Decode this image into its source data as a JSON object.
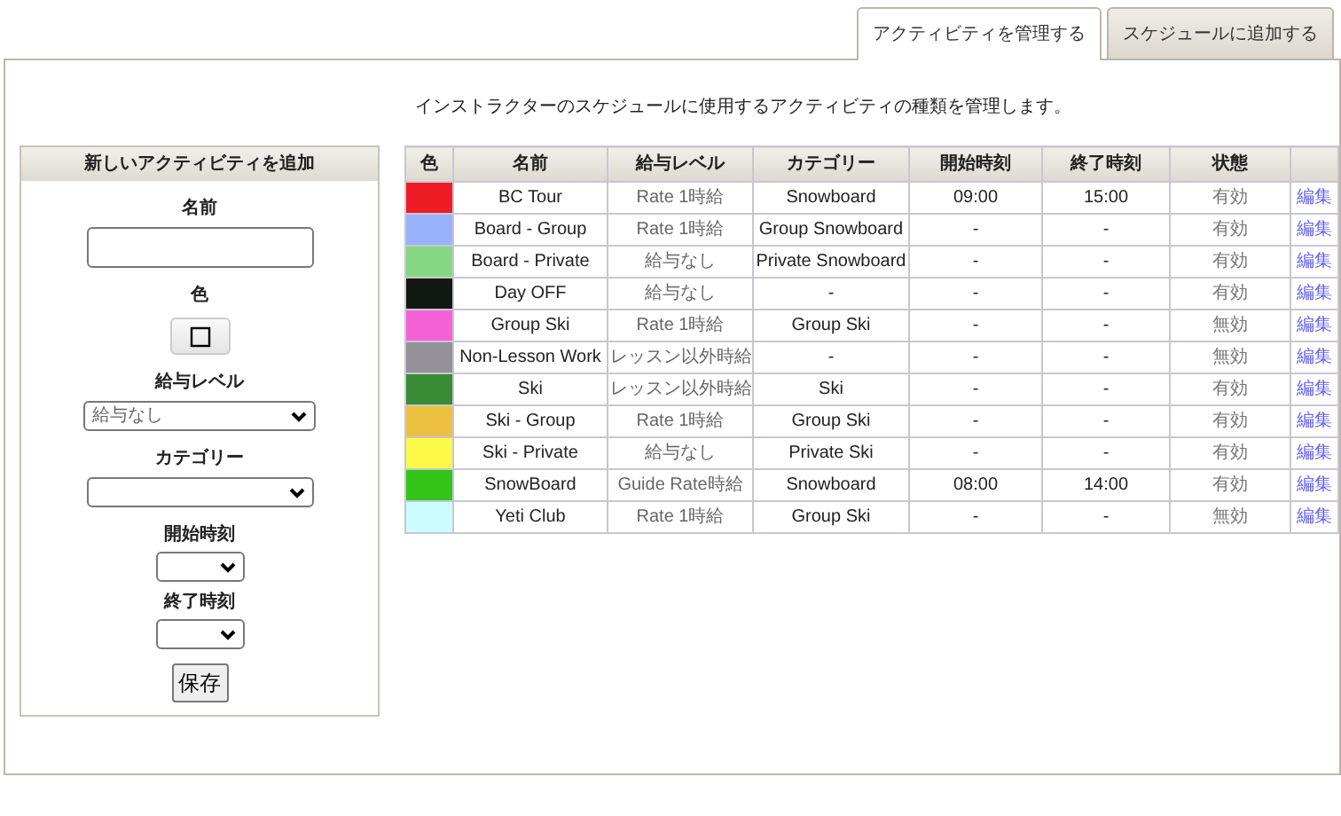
{
  "tabs": [
    {
      "label": "アクティビティを管理する",
      "selected": true
    },
    {
      "label": "スケジュールに追加する",
      "selected": false
    }
  ],
  "description": "インストラクターのスケジュールに使用するアクティビティの種類を管理します。",
  "form": {
    "title": "新しいアクティビティを追加",
    "fields": [
      {
        "label": "名前",
        "kind": "text"
      },
      {
        "label": "色",
        "kind": "color"
      },
      {
        "label": "給与レベル",
        "kind": "select",
        "value": "給与なし"
      },
      {
        "label": "カテゴリー",
        "kind": "select"
      },
      {
        "label": "開始時刻",
        "kind": "time"
      },
      {
        "label": "終了時刻",
        "kind": "time"
      }
    ],
    "save_button": "保存"
  },
  "table": {
    "columns": [
      "色",
      "名前",
      "給与レベル",
      "カテゴリー",
      "開始時刻",
      "終了時刻",
      "状態"
    ],
    "rows": [
      {
        "color": "#ee1c25",
        "name": "BC Tour",
        "pay_level": "Rate 1時給",
        "category": "Snowboard",
        "start": "09:00",
        "end": "15:00",
        "status": "有効",
        "action": "編集"
      },
      {
        "color": "#99b3fa",
        "name": "Board - Group",
        "pay_level": "Rate 1時給",
        "category": "Group Snowboard",
        "start": "-",
        "end": "-",
        "status": "有効",
        "action": "編集"
      },
      {
        "color": "#86d784",
        "name": "Board - Private",
        "pay_level": "給与なし",
        "category": "Private Snowboard",
        "start": "-",
        "end": "-",
        "status": "有効",
        "action": "編集"
      },
      {
        "color": "#111811",
        "name": "Day OFF",
        "pay_level": "給与なし",
        "category": "-",
        "start": "-",
        "end": "-",
        "status": "有効",
        "action": "編集"
      },
      {
        "color": "#f562d5",
        "name": "Group Ski",
        "pay_level": "Rate 1時給",
        "category": "Group Ski",
        "start": "-",
        "end": "-",
        "status": "無効",
        "action": "編集"
      },
      {
        "color": "#959199",
        "name": "Non-Lesson Work",
        "pay_level": "レッスン以外時給",
        "category": "-",
        "start": "-",
        "end": "-",
        "status": "無効",
        "action": "編集"
      },
      {
        "color": "#3a8b33",
        "name": "Ski",
        "pay_level": "レッスン以外時給",
        "category": "Ski",
        "start": "-",
        "end": "-",
        "status": "有効",
        "action": "編集"
      },
      {
        "color": "#ecc040",
        "name": "Ski - Group",
        "pay_level": "Rate 1時給",
        "category": "Group Ski",
        "start": "-",
        "end": "-",
        "status": "有効",
        "action": "編集"
      },
      {
        "color": "#fcfa46",
        "name": "Ski - Private",
        "pay_level": "給与なし",
        "category": "Private Ski",
        "start": "-",
        "end": "-",
        "status": "有効",
        "action": "編集"
      },
      {
        "color": "#32c518",
        "name": "SnowBoard",
        "pay_level": "Guide Rate時給",
        "category": "Snowboard",
        "start": "08:00",
        "end": "14:00",
        "status": "有効",
        "action": "編集"
      },
      {
        "color": "#ccfdfe",
        "name": "Yeti Club",
        "pay_level": "Rate 1時給",
        "category": "Group Ski",
        "start": "-",
        "end": "-",
        "status": "無効",
        "action": "編集"
      }
    ]
  }
}
